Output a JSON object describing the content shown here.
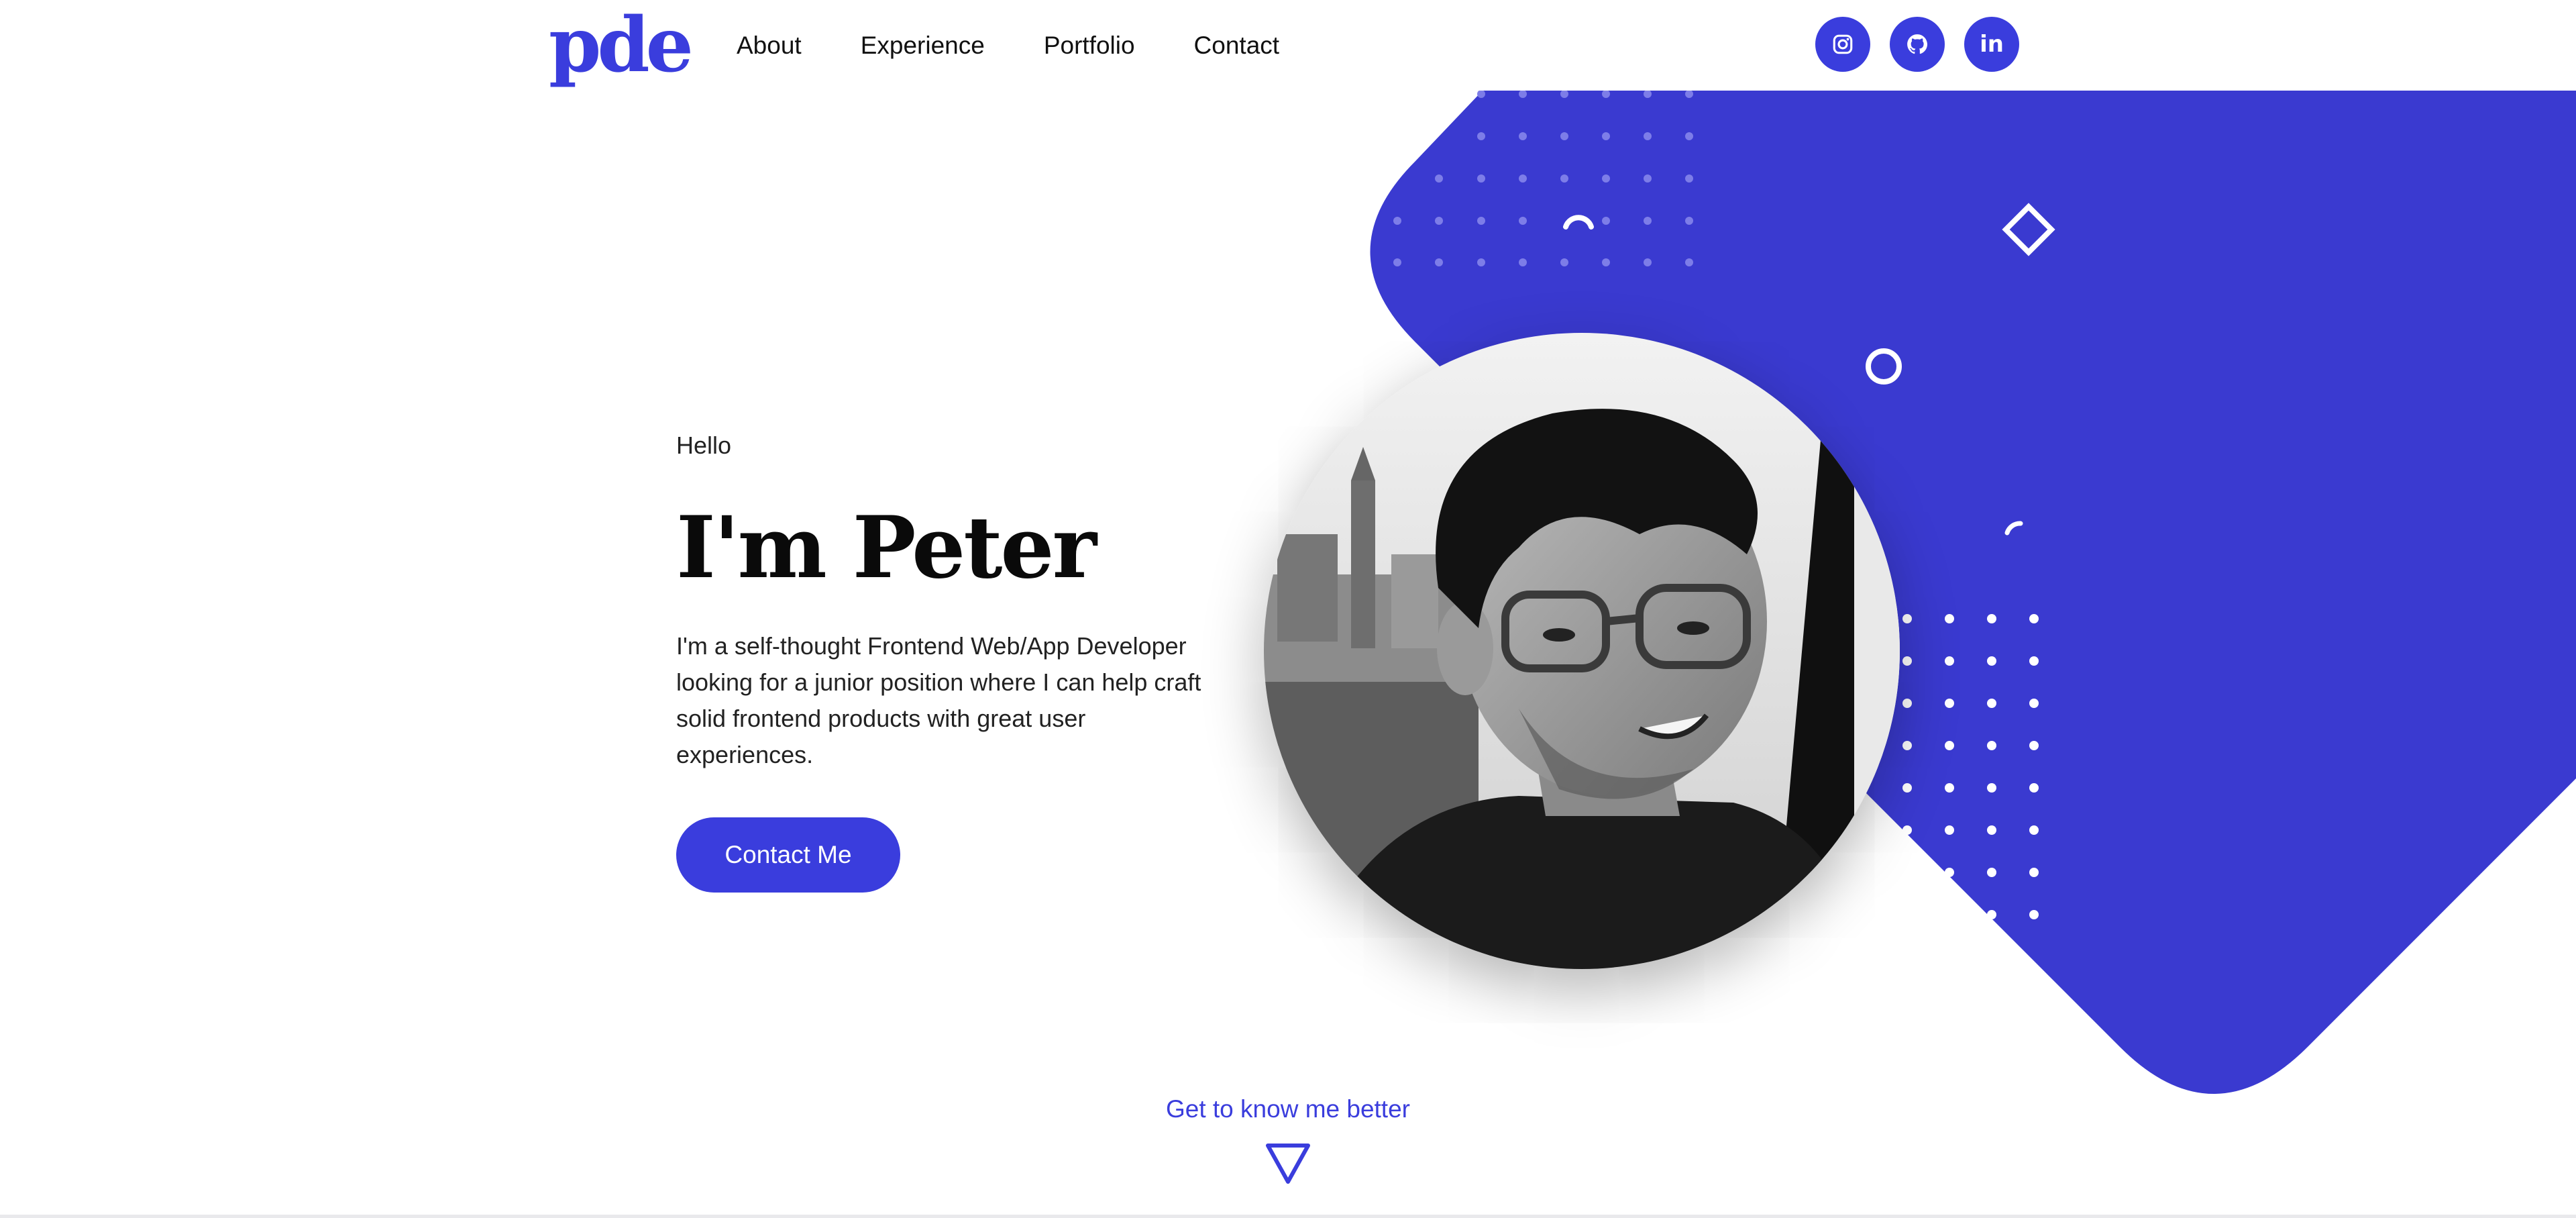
{
  "header": {
    "logo_text": "pde",
    "nav": [
      {
        "label": "About"
      },
      {
        "label": "Experience"
      },
      {
        "label": "Portfolio"
      },
      {
        "label": "Contact"
      }
    ],
    "social": [
      {
        "icon": "instagram-icon"
      },
      {
        "icon": "github-icon"
      },
      {
        "icon": "linkedin-icon",
        "text": "in"
      }
    ]
  },
  "hero": {
    "greeting": "Hello",
    "title": "I'm Peter",
    "description": "I'm a self-thought Frontend Web/App Developer looking for a junior position where I can help craft solid frontend products with great user experiences.",
    "cta_label": "Contact Me",
    "portrait": "profile-photo"
  },
  "footer": {
    "know_more": "Get to know me better",
    "arrow_icon": "down-triangle-icon"
  },
  "colors": {
    "accent": "#3a3ddd",
    "text": "#111111",
    "background": "#ffffff"
  }
}
